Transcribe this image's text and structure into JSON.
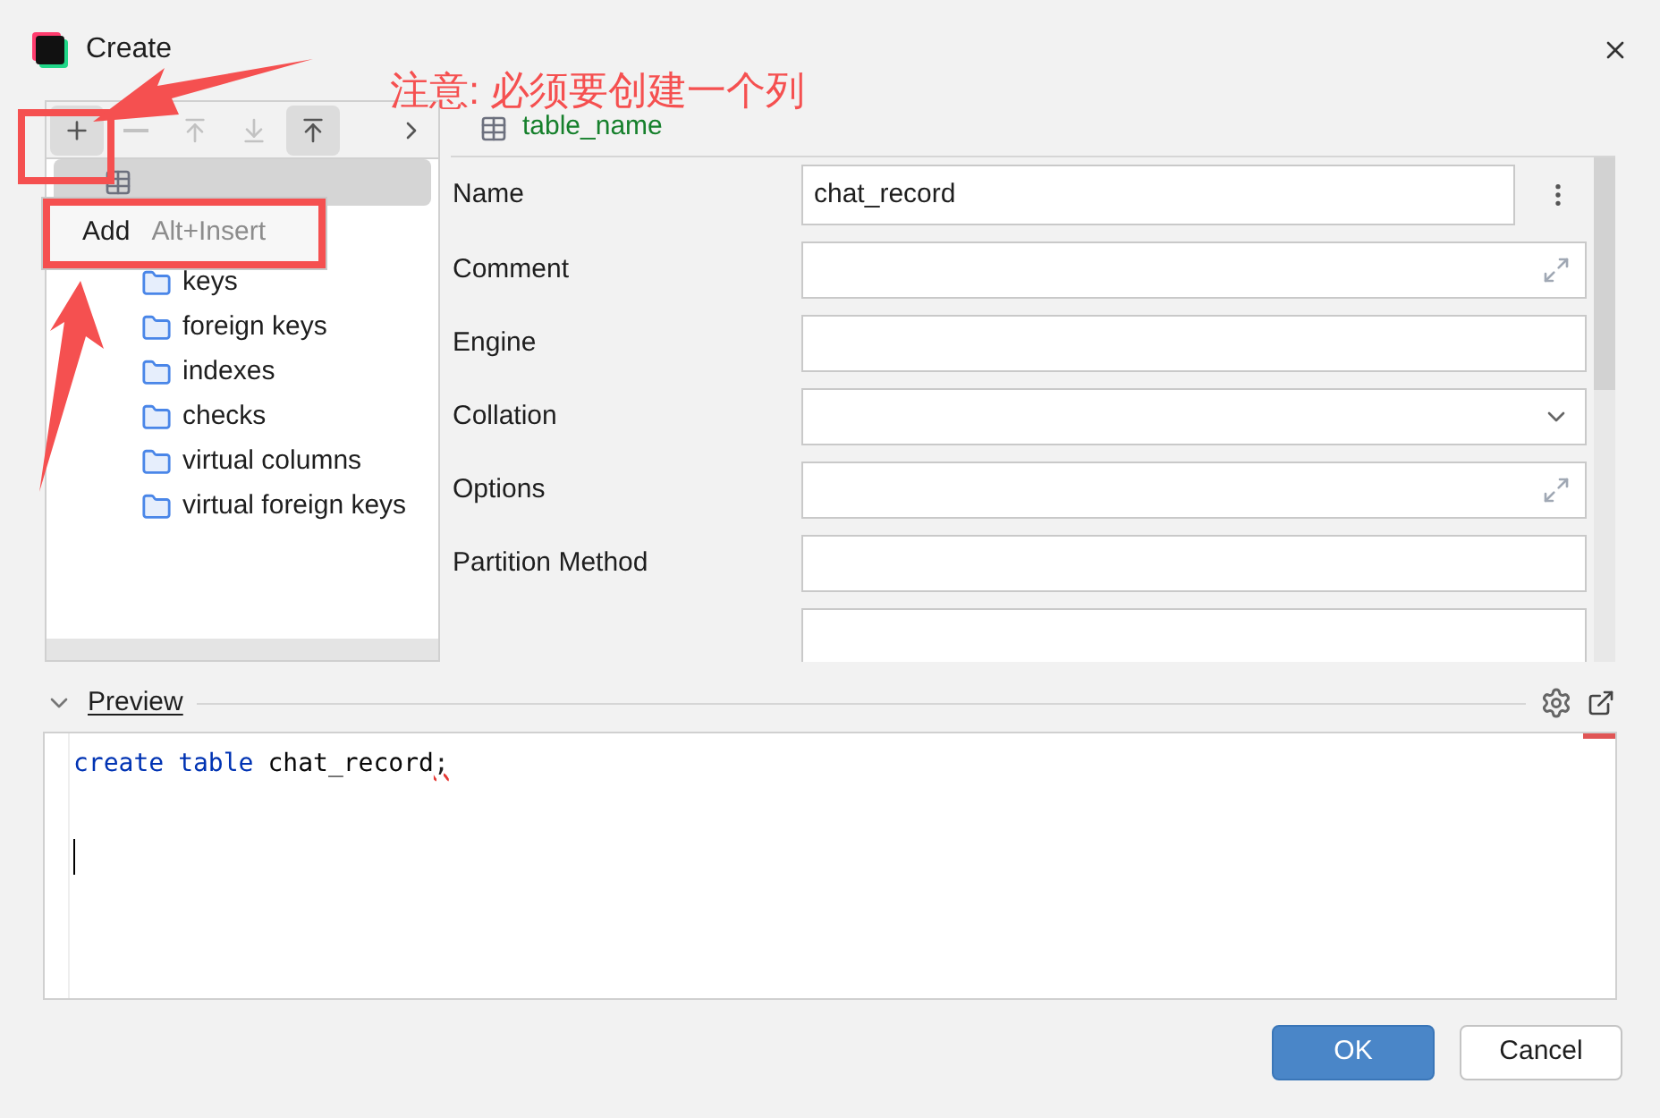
{
  "window": {
    "title": "Create"
  },
  "annotation": {
    "text": "注意: 必须要创建一个列"
  },
  "toolbar": [
    {
      "kind": "add",
      "disabled": false,
      "selected": true
    },
    {
      "kind": "remove",
      "disabled": true,
      "selected": false
    },
    {
      "kind": "up",
      "disabled": true,
      "selected": false
    },
    {
      "kind": "down",
      "disabled": true,
      "selected": false
    },
    {
      "kind": "top",
      "disabled": false,
      "selected": true
    },
    {
      "kind": "more",
      "disabled": false,
      "selected": false
    }
  ],
  "tree": {
    "root": {
      "selected": true
    },
    "children": [
      {
        "label": "keys"
      },
      {
        "label": "foreign keys"
      },
      {
        "label": "indexes"
      },
      {
        "label": "checks"
      },
      {
        "label": "virtual columns"
      },
      {
        "label": "virtual foreign keys"
      }
    ]
  },
  "popup_menu": {
    "label": "Add",
    "shortcut": "Alt+Insert"
  },
  "header": {
    "title": "table_name"
  },
  "form": [
    {
      "label": "Name",
      "kind": "menu",
      "value": "chat_record"
    },
    {
      "label": "Comment",
      "kind": "expand"
    },
    {
      "label": "Engine",
      "kind": "text"
    },
    {
      "label": "Collation",
      "kind": "dropdown"
    },
    {
      "label": "Options",
      "kind": "expand"
    },
    {
      "label": "Partition Method",
      "kind": "text"
    },
    {
      "kind": "text"
    }
  ],
  "preview": {
    "title": "Preview",
    "expanded": true,
    "code": [
      [
        {
          "kind": "keyword",
          "text": "create"
        },
        {
          "kind": "keyword",
          "text": "table"
        },
        {
          "kind": "plain",
          "text": "chat_record"
        },
        {
          "kind": "error",
          "text": ";"
        }
      ],
      [
        {
          "kind": "cursor"
        }
      ]
    ]
  },
  "buttons": [
    {
      "label": "OK",
      "primary": true
    },
    {
      "label": "Cancel",
      "primary": false
    }
  ]
}
